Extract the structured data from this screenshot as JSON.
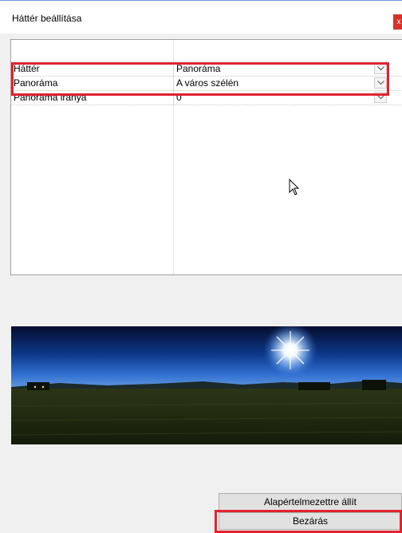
{
  "window": {
    "title": "Háttér beállítása",
    "close_glyph": "x"
  },
  "properties": [
    {
      "label": "Háttér",
      "value": "Panoráma"
    },
    {
      "label": "Panoráma",
      "value": "A város szélén"
    },
    {
      "label": "Panoráma iránya",
      "value": "0"
    }
  ],
  "buttons": {
    "reset_label": "Alapértelmezettre állít",
    "close_label": "Bezárás"
  },
  "colors": {
    "highlight": "#e0232e",
    "dialog_bg": "#f0f0f0",
    "button_bg": "#e1e1e1"
  },
  "icons": [
    "close-icon",
    "chevron-down-icon",
    "mouse-cursor-icon"
  ]
}
